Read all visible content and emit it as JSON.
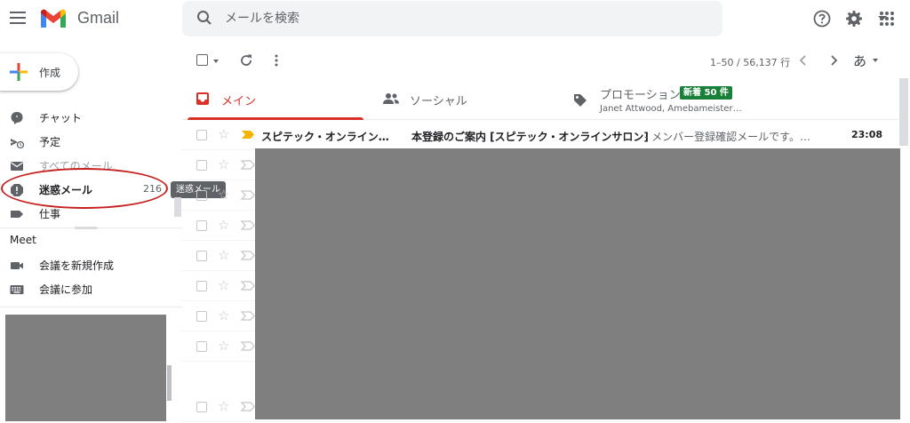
{
  "header": {
    "app_name": "Gmail",
    "search_placeholder": "メールを検索"
  },
  "sidebar": {
    "compose_label": "作成",
    "items": [
      {
        "label": "チャット",
        "icon": "chat-icon"
      },
      {
        "label": "予定",
        "icon": "scheduled-icon"
      },
      {
        "label": "すべてのメール",
        "icon": "all-mail-icon"
      },
      {
        "label": "迷惑メール",
        "count": "216",
        "icon": "spam-icon"
      },
      {
        "label": "仕事",
        "icon": "label-icon"
      }
    ],
    "tooltip": "迷惑メール",
    "meet": {
      "heading": "Meet",
      "items": [
        {
          "label": "会議を新規作成",
          "icon": "video-icon"
        },
        {
          "label": "会議に参加",
          "icon": "keyboard-icon"
        }
      ]
    }
  },
  "toolbar": {
    "pager": "1–50 / 56,137 行",
    "input_tool": "あ"
  },
  "tabs": [
    {
      "label": "メイン",
      "icon": "inbox-icon",
      "active": true
    },
    {
      "label": "ソーシャル",
      "icon": "people-icon"
    },
    {
      "label": "プロモーション",
      "icon": "tag-icon",
      "badge": "新着 50 件",
      "subtitle": "Janet Attwood, Amebameister…"
    }
  ],
  "emails": [
    {
      "sender": "スピテック・オンライン…",
      "subject": "本登録のご案内 [スピテック・オンラインサロン]",
      "snippet": " - メンバー登録確認メールです。…",
      "time": "23:08"
    }
  ],
  "colors": {
    "accent_red": "#d93025",
    "badge_green": "#188038",
    "highlight_circle": "#c5221f",
    "redaction_gray": "#7f7f7f"
  }
}
